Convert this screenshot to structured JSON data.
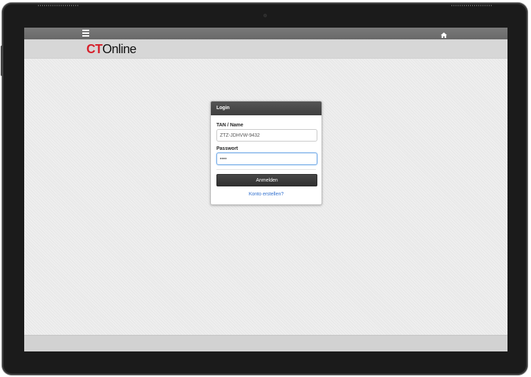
{
  "brand": {
    "logo_ct": "CT",
    "logo_online": "Online",
    "ct_color": "#d6202b"
  },
  "topbar": {
    "menu_icon": "hamburger-menu-icon",
    "home_icon": "home-icon"
  },
  "login": {
    "title": "Login",
    "tan_label": "TAN / Name",
    "tan_value": "ZTZ-JDHVW-9432",
    "password_label": "Passwort",
    "password_value": "••••",
    "submit_label": "Anmelden",
    "create_account_link": "Konto erstellen?"
  }
}
